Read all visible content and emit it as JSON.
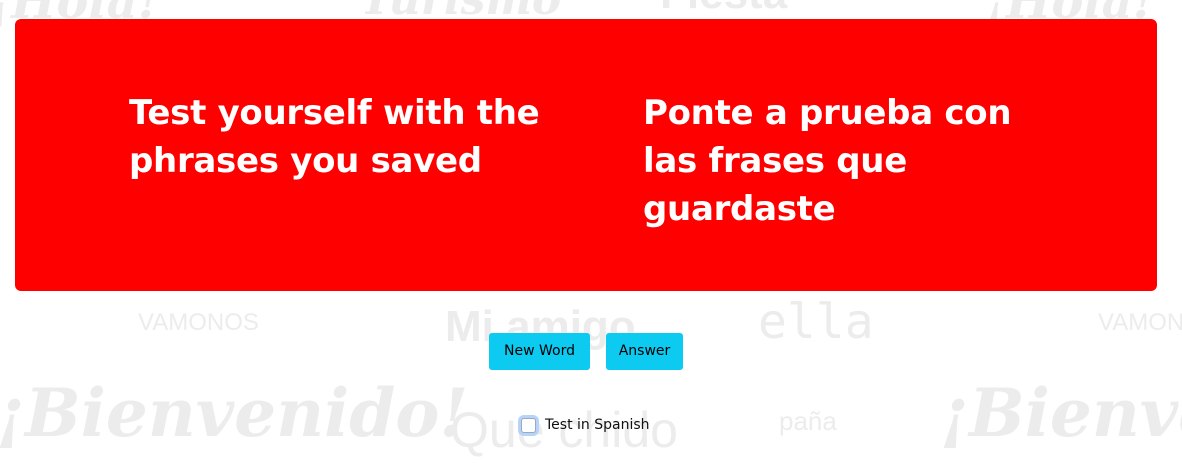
{
  "background": {
    "words": [
      "¡Hola!",
      "Turismo",
      "Fiesta",
      "¡Hola!",
      "VAMONOS",
      "Mi amigo",
      "ella",
      "VAMONOS",
      "¡Bienvenido!",
      "Que chido",
      "paña",
      "¡Bienve"
    ]
  },
  "hero": {
    "english": "Test yourself with the phrases you saved",
    "spanish": "Ponte a prueba con las frases que guardaste",
    "color": "#ff0000"
  },
  "buttons": {
    "new_word": "New Word",
    "answer": "Answer",
    "color": "#0dcaf0"
  },
  "options": {
    "test_in_spanish_label": "Test in Spanish",
    "test_in_spanish_checked": false
  }
}
